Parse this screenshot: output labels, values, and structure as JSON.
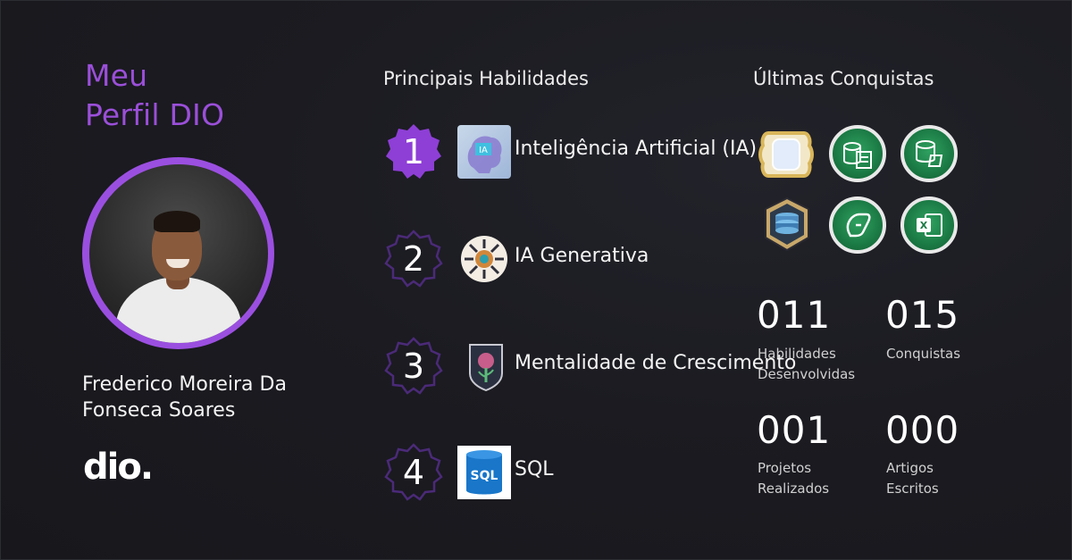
{
  "profile": {
    "title": "Meu\nPerfil DIO",
    "title_line1": "Meu",
    "title_line2": "Perfil DIO",
    "name": "Frederico Moreira Da Fonseca Soares",
    "logo_text": "dio."
  },
  "skills": {
    "title": "Principais Habilidades",
    "items": [
      {
        "rank": "1",
        "label": "Inteligência Artificial (IA)",
        "icon": "ai-brain-icon"
      },
      {
        "rank": "2",
        "label": "IA Generativa",
        "icon": "generative-ai-icon"
      },
      {
        "rank": "3",
        "label": "Mentalidade de Crescimento",
        "icon": "growth-mindset-icon"
      },
      {
        "rank": "4",
        "label": "SQL",
        "icon": "sql-database-icon"
      }
    ]
  },
  "achievements": {
    "title": "Últimas Conquistas",
    "badges": [
      "golden-shield-icon",
      "data-sheet-icon",
      "database-icon",
      "layers-shield-icon",
      "copilot-icon",
      "excel-icon"
    ]
  },
  "stats": [
    {
      "value": "011",
      "label": "Habilidades Desenvolvidas"
    },
    {
      "value": "015",
      "label": "Conquistas"
    },
    {
      "value": "001",
      "label": "Projetos Realizados"
    },
    {
      "value": "000",
      "label": "Artigos Escritos"
    }
  ],
  "colors": {
    "accent": "#9b4fd9",
    "badge_purple": "#8e3fd6",
    "badge_outline": "#4b2a78",
    "background": "#1b1b21"
  }
}
